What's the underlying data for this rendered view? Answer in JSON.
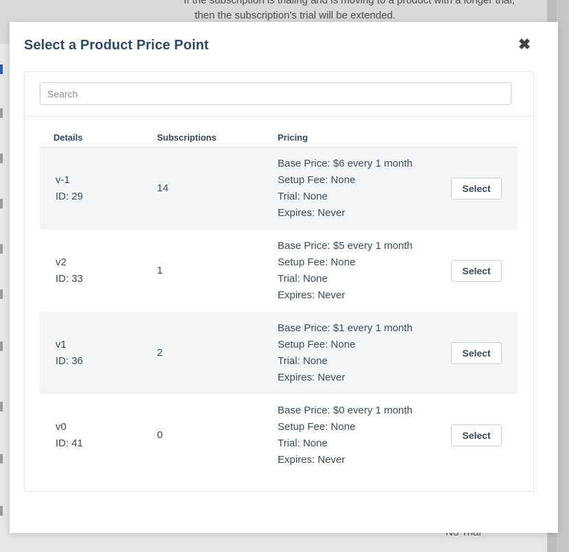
{
  "background": {
    "note_line1": "If the subscription is trialing and is moving to a product with a longer trial,",
    "note_line2": "then the subscription's trial will be extended.",
    "bottom_text": "No Trial"
  },
  "modal": {
    "title": "Select a Product Price Point",
    "close_icon": "close-icon",
    "search": {
      "placeholder": "Search",
      "value": ""
    },
    "columns": {
      "details": "Details",
      "subscriptions": "Subscriptions",
      "pricing": "Pricing"
    },
    "rows": [
      {
        "name": "v-1",
        "id": "ID: 29",
        "subscriptions": "14",
        "base_price": "Base Price: $6 every 1 month",
        "setup_fee": "Setup Fee: None",
        "trial": "Trial: None",
        "expires": "Expires: Never",
        "button": "Select"
      },
      {
        "name": "v2",
        "id": "ID: 33",
        "subscriptions": "1",
        "base_price": "Base Price: $5 every 1 month",
        "setup_fee": "Setup Fee: None",
        "trial": "Trial: None",
        "expires": "Expires: Never",
        "button": "Select"
      },
      {
        "name": "v1",
        "id": "ID: 36",
        "subscriptions": "2",
        "base_price": "Base Price: $1 every 1 month",
        "setup_fee": "Setup Fee: None",
        "trial": "Trial: None",
        "expires": "Expires: Never",
        "button": "Select"
      },
      {
        "name": "v0",
        "id": "ID: 41",
        "subscriptions": "0",
        "base_price": "Base Price: $0 every 1 month",
        "setup_fee": "Setup Fee: None",
        "trial": "Trial: None",
        "expires": "Expires: Never",
        "button": "Select"
      }
    ]
  },
  "colors": {
    "title": "#2e4a6b",
    "text": "#3c4a58",
    "stripe": "#f4f5f6"
  }
}
